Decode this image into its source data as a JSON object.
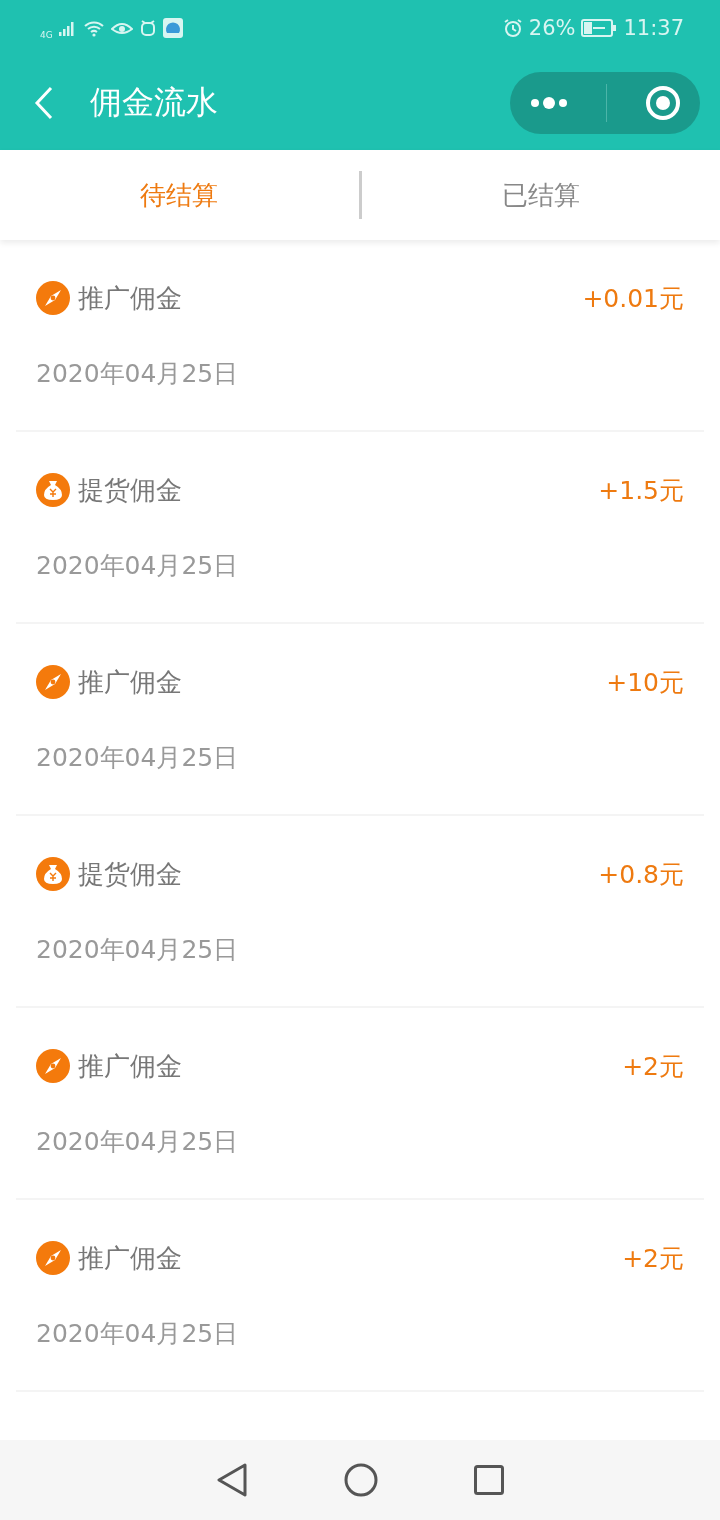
{
  "status_bar": {
    "network": "4G",
    "battery": "26%",
    "time": "11:37"
  },
  "header": {
    "title": "佣金流水"
  },
  "tabs": [
    {
      "label": "待结算",
      "selected": true
    },
    {
      "label": "已结算",
      "selected": false
    }
  ],
  "records": [
    {
      "kind": "promo",
      "title": "推广佣金",
      "amount": "+0.01元",
      "date": "2020年04月25日"
    },
    {
      "kind": "pickup",
      "title": "提货佣金",
      "amount": "+1.5元",
      "date": "2020年04月25日"
    },
    {
      "kind": "promo",
      "title": "推广佣金",
      "amount": "+10元",
      "date": "2020年04月25日"
    },
    {
      "kind": "pickup",
      "title": "提货佣金",
      "amount": "+0.8元",
      "date": "2020年04月25日"
    },
    {
      "kind": "promo",
      "title": "推广佣金",
      "amount": "+2元",
      "date": "2020年04月25日"
    },
    {
      "kind": "promo",
      "title": "推广佣金",
      "amount": "+2元",
      "date": "2020年04月25日"
    }
  ]
}
